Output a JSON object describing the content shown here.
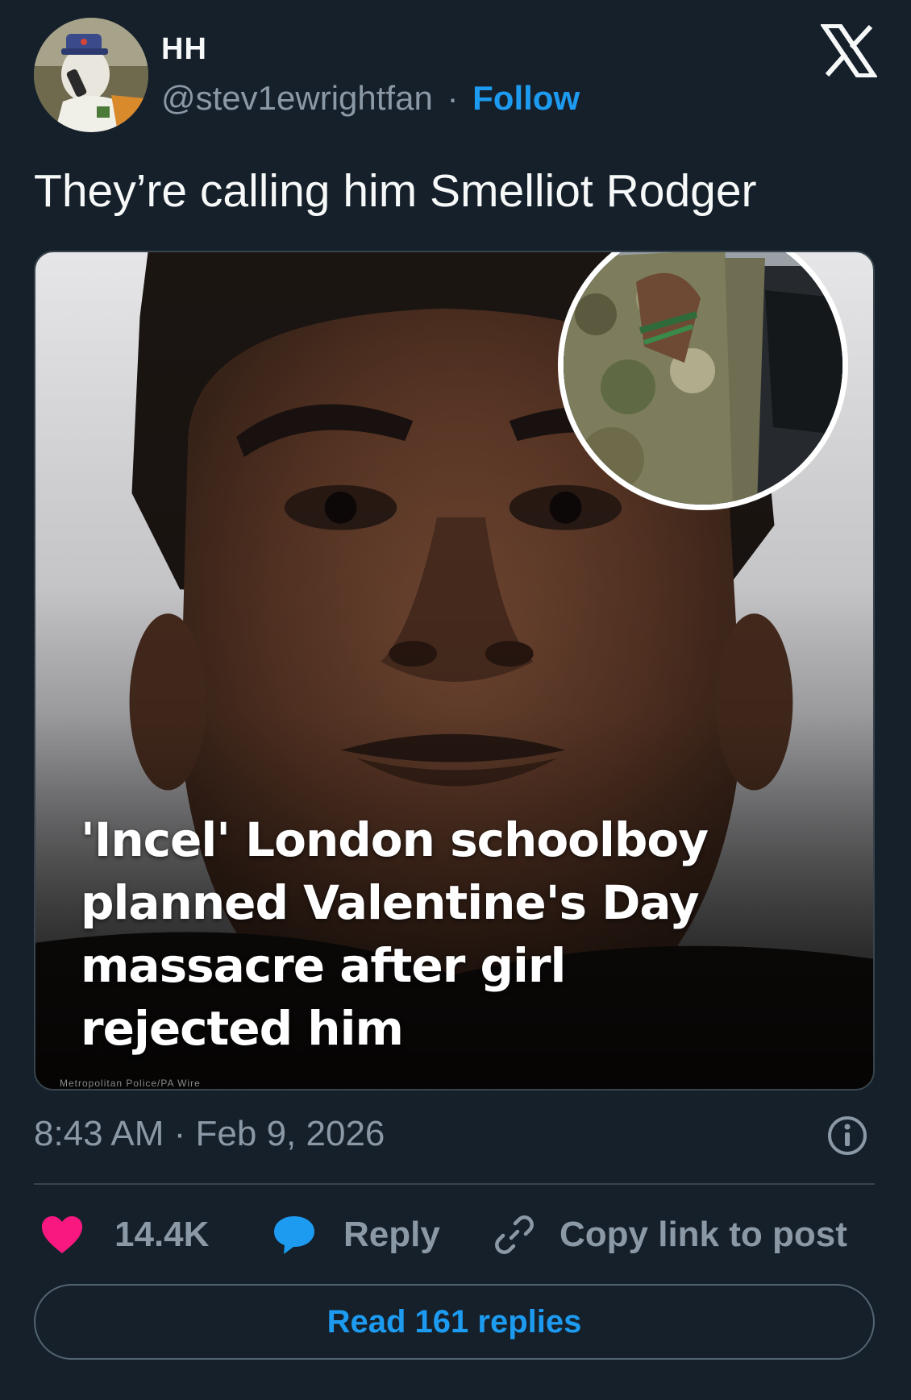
{
  "post": {
    "author_name": "HH",
    "author_handle": "@stev1ewrightfan",
    "separator": "·",
    "follow_label": "Follow",
    "text": "They’re calling him Smelliot Rodger",
    "timestamp": "8:43 AM · Feb 9, 2026"
  },
  "media": {
    "headline_lines": [
      "'Incel' London schoolboy",
      "planned Valentine's Day",
      "massacre after girl",
      "rejected him"
    ],
    "credit": "Metropolitan Police/PA Wire"
  },
  "actions": {
    "like_count": "14.4K",
    "reply_label": "Reply",
    "copy_link_label": "Copy link to post"
  },
  "footer": {
    "read_replies_label": "Read 161 replies"
  },
  "colors": {
    "background": "#15202b",
    "accent": "#1d9bf0",
    "muted_text": "#8b98a5",
    "like_heart": "#f91880",
    "divider": "#38444d"
  },
  "icons": {
    "brand": "x-logo-icon",
    "info": "info-icon",
    "like": "heart-icon",
    "reply": "speech-bubble-icon",
    "copy": "link-icon"
  }
}
